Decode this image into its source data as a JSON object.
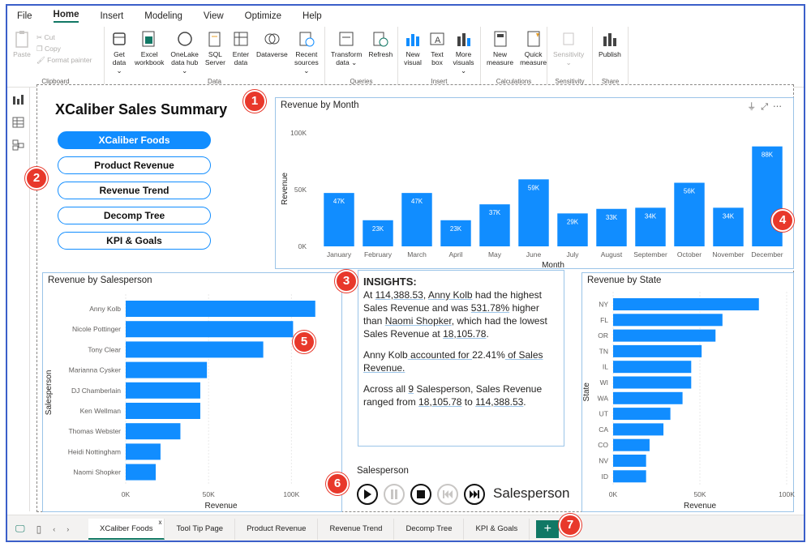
{
  "menu": [
    "File",
    "Home",
    "Insert",
    "Modeling",
    "View",
    "Optimize",
    "Help"
  ],
  "ribbon": {
    "clipboard": {
      "label": "Clipboard",
      "paste": "Paste",
      "cut": "Cut",
      "copy": "Copy",
      "format_painter": "Format painter"
    },
    "data": {
      "label": "Data",
      "buttons": [
        [
          "Get",
          "data ⌄"
        ],
        [
          "Excel",
          "workbook"
        ],
        [
          "OneLake",
          "data hub ⌄"
        ],
        [
          "SQL",
          "Server"
        ],
        [
          "Enter",
          "data"
        ],
        [
          "Dataverse",
          ""
        ],
        [
          "Recent",
          "sources ⌄"
        ]
      ]
    },
    "queries": {
      "label": "Queries",
      "buttons": [
        [
          "Transform",
          "data ⌄"
        ],
        [
          "Refresh",
          ""
        ]
      ]
    },
    "insert": {
      "label": "Insert",
      "buttons": [
        [
          "New",
          "visual"
        ],
        [
          "Text",
          "box"
        ],
        [
          "More",
          "visuals ⌄"
        ]
      ]
    },
    "calculations": {
      "label": "Calculations",
      "buttons": [
        [
          "New",
          "measure"
        ],
        [
          "Quick",
          "measure"
        ]
      ]
    },
    "sensitivity": {
      "label": "Sensitivity",
      "buttons": [
        [
          "Sensitivity",
          "⌄"
        ]
      ]
    },
    "share": {
      "label": "Share",
      "buttons": [
        [
          "Publish",
          ""
        ]
      ]
    }
  },
  "report": {
    "title": "XCaliber Sales Summary",
    "nav_buttons": [
      "XCaliber Foods",
      "Product Revenue",
      "Revenue Trend",
      "Decomp Tree",
      "KPI & Goals"
    ]
  },
  "colors": {
    "accent": "#118dff",
    "badge": "#e8382b",
    "tab_accent": "#117865"
  },
  "chart_data": [
    {
      "type": "bar",
      "title": "Revenue by Month",
      "xlabel": "Month",
      "ylabel": "Revenue",
      "categories": [
        "January",
        "February",
        "March",
        "April",
        "May",
        "June",
        "July",
        "August",
        "September",
        "October",
        "November",
        "December"
      ],
      "values": [
        47,
        23,
        47,
        23,
        37,
        59,
        29,
        33,
        34,
        56,
        34,
        88
      ],
      "data_labels": [
        "47K",
        "23K",
        "47K",
        "23K",
        "37K",
        "59K",
        "29K",
        "33K",
        "34K",
        "56K",
        "34K",
        "88K"
      ],
      "yticks": [
        "0K",
        "50K",
        "100K"
      ],
      "ylim": [
        0,
        100
      ]
    },
    {
      "type": "bar",
      "orientation": "horizontal",
      "title": "Revenue by Salesperson",
      "xlabel": "Revenue",
      "ylabel": "Salesperson",
      "categories": [
        "Anny Kolb",
        "Nicole Pottinger",
        "Tony Clear",
        "Marianna Cysker",
        "DJ Chamberlain",
        "Ken Wellman",
        "Thomas Webster",
        "Heidi Nottingham",
        "Naomi Shopker"
      ],
      "values": [
        114.39,
        101,
        83,
        49,
        45,
        45,
        33,
        21,
        18.11
      ],
      "xticks": [
        "0K",
        "50K",
        "100K"
      ],
      "xlim": [
        0,
        115
      ]
    },
    {
      "type": "bar",
      "orientation": "horizontal",
      "title": "Revenue by State",
      "xlabel": "Revenue",
      "ylabel": "State",
      "categories": [
        "NY",
        "FL",
        "OR",
        "TN",
        "IL",
        "WI",
        "WA",
        "UT",
        "CA",
        "CO",
        "NV",
        "ID"
      ],
      "values": [
        84,
        63,
        59,
        51,
        45,
        45,
        40,
        33,
        29,
        21,
        19,
        19
      ],
      "xticks": [
        "0K",
        "50K",
        "100K"
      ],
      "xlim": [
        0,
        100
      ]
    }
  ],
  "insights": {
    "heading": "INSIGHTS:",
    "p1": [
      "At ",
      "114,388.53",
      ", ",
      "Anny Kolb",
      " had the highest Sales Revenue and was ",
      "531.78%",
      " higher than ",
      "Naomi Shopker",
      ", which had the lowest Sales Revenue at ",
      "18,105.78",
      "."
    ],
    "p2": [
      "Anny Kolb",
      " accounted for ",
      "22.41%",
      " of Sales Revenue."
    ],
    "p3": [
      "Across all ",
      "9",
      " Salesperson, Sales Revenue ranged from ",
      "18,105.78",
      " to ",
      "114,388.53",
      "."
    ]
  },
  "play_axis": {
    "label": "Salesperson",
    "current": "Salesperson"
  },
  "badges": [
    "1",
    "2",
    "3",
    "4",
    "5",
    "6",
    "7"
  ],
  "pages": [
    "XCaliber Foods",
    "Tool Tip Page",
    "Product Revenue",
    "Revenue Trend",
    "Decomp Tree",
    "KPI & Goals"
  ],
  "add_page": "+",
  "close_tab": "x"
}
